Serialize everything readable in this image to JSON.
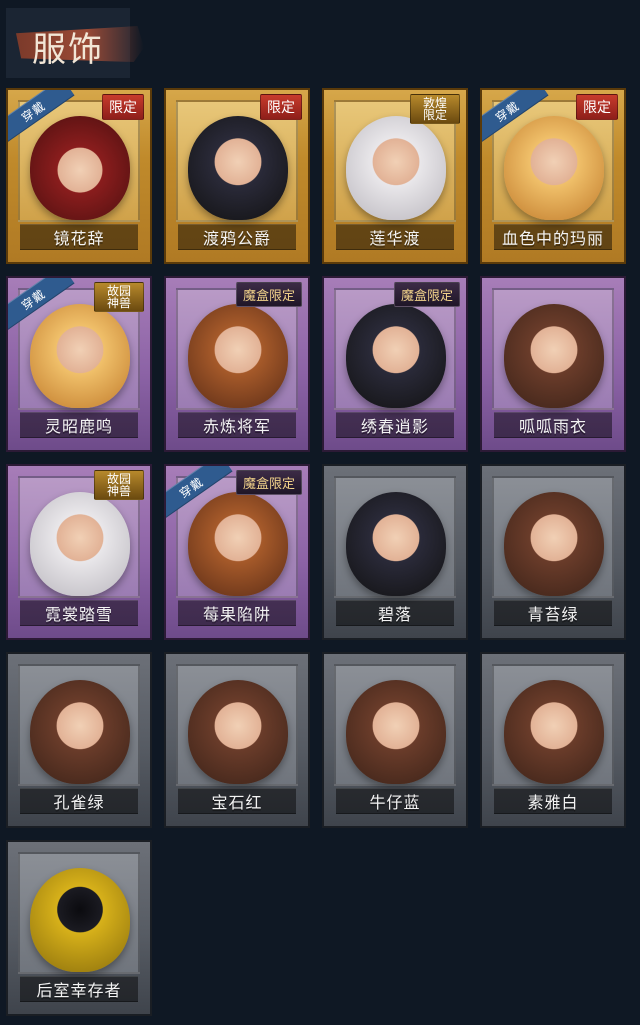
{
  "header": {
    "title": "服饰"
  },
  "cards": [
    {
      "name": "镜花辞",
      "badge": "限定",
      "wearing": "穿戴",
      "frame": "gold",
      "portrait": "hood"
    },
    {
      "name": "渡鸦公爵",
      "badge": "限定",
      "wearing": "",
      "frame": "gold",
      "portrait": "dark"
    },
    {
      "name": "莲华渡",
      "badge": "敦煌\n限定",
      "wearing": "",
      "frame": "gold",
      "portrait": "white"
    },
    {
      "name": "血色中的玛丽",
      "badge": "限定",
      "wearing": "穿戴",
      "frame": "gold",
      "portrait": "blonde"
    },
    {
      "name": "灵昭鹿鸣",
      "badge": "故园\n神兽",
      "wearing": "穿戴",
      "frame": "purple",
      "portrait": "blonde"
    },
    {
      "name": "赤炼将军",
      "badge": "魔盒限定",
      "wearing": "",
      "frame": "purple",
      "portrait": "orange"
    },
    {
      "name": "绣春逍影",
      "badge": "魔盒限定",
      "wearing": "",
      "frame": "purple",
      "portrait": "dark"
    },
    {
      "name": "呱呱雨衣",
      "badge": "",
      "wearing": "",
      "frame": "purple",
      "portrait": "green"
    },
    {
      "name": "霓裳踏雪",
      "badge": "故园\n神兽",
      "wearing": "",
      "frame": "purple",
      "portrait": "white"
    },
    {
      "name": "莓果陷阱",
      "badge": "魔盒限定",
      "wearing": "穿戴",
      "frame": "purple",
      "portrait": "orange"
    },
    {
      "name": "碧落",
      "badge": "",
      "wearing": "",
      "frame": "gray",
      "portrait": "dark"
    },
    {
      "name": "青苔绿",
      "badge": "",
      "wearing": "",
      "frame": "gray",
      "portrait": "green"
    },
    {
      "name": "孔雀绿",
      "badge": "",
      "wearing": "",
      "frame": "gray",
      "portrait": "green"
    },
    {
      "name": "宝石红",
      "badge": "",
      "wearing": "",
      "frame": "gray",
      "portrait": "green"
    },
    {
      "name": "牛仔蓝",
      "badge": "",
      "wearing": "",
      "frame": "gray",
      "portrait": "green"
    },
    {
      "name": "素雅白",
      "badge": "",
      "wearing": "",
      "frame": "gray",
      "portrait": "green"
    },
    {
      "name": "后室幸存者",
      "badge": "",
      "wearing": "",
      "frame": "gray",
      "portrait": "gas"
    }
  ]
}
